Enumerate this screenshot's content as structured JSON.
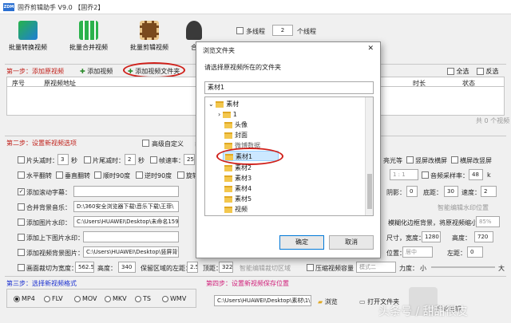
{
  "window": {
    "logo_text": "ZDM",
    "title": "固乔剪辑助手 V9.0 【固乔2】"
  },
  "toolbar": {
    "buttons": [
      {
        "label": "批量转换视频",
        "icon": "convert-icon"
      },
      {
        "label": "批量合并视频",
        "icon": "merge-icon"
      },
      {
        "label": "批量剪辑视频",
        "icon": "film-edit-icon"
      },
      {
        "label": "合",
        "icon": "users-icon"
      }
    ],
    "multithread_label": "多线程",
    "thread_count": "2",
    "thread_unit": "个线程"
  },
  "step1": {
    "title": "第一步：添加原视频",
    "add_video": "添加视频",
    "add_folder": "添加视频文件夹",
    "select_all": "全选",
    "invert": "反选",
    "columns": [
      "序号",
      "原视频地址",
      "时长",
      "状态"
    ],
    "total": "共 0 个视频"
  },
  "step2": {
    "title": "第二步：设置新视频选项",
    "advanced": "高级自定义",
    "edit": "编辑",
    "row1": {
      "cut_head": "片头减时：",
      "cut_head_val": "3",
      "sec1": "秒",
      "cut_tail": "片尾减时：",
      "cut_tail_val": "2",
      "sec2": "秒",
      "fps": "帧速率：",
      "fps_val": "25"
    },
    "row1_right": {
      "light": "亮光等",
      "vert_screen": "竖屏改横屏",
      "horiz_screen": "横屏改竖屏"
    },
    "row2": {
      "hflip": "水平翻转",
      "vflip": "垂直翻转",
      "cw90": "顺时90度",
      "ccw90": "逆时90度",
      "rotate": "旋转"
    },
    "row2_right": {
      "ratio": "1 : 1",
      "sample_rate": "音频采样率：",
      "sample_val": "48",
      "unit": "k"
    },
    "row3": {
      "subtitle": "添加滚动字幕："
    },
    "row3_right": {
      "shadow": "阴影：",
      "shadow_val": "0",
      "bottom": "底距：",
      "bottom_val": "30",
      "speed": "速度：",
      "speed_val": "2"
    },
    "row4": {
      "merge_audio": "合并背景音乐：",
      "merge_path": "D:\\360安全浏览器下载\\音乐下载\\王菲\\"
    },
    "row4_right": {
      "smart": "智能编辑水印位置"
    },
    "row5": {
      "watermark": "添加图片水印：",
      "wm_path": "C:\\Users\\HUAWEI\\Desktop\\未命名15940"
    },
    "row5_right": {
      "blur": "模糊化边框背景，将原视频缩小到：",
      "blur_val": "85%"
    },
    "row6": {
      "topbottom": "添加上下图片水印："
    },
    "row6_right": {
      "size_label": "尺寸，宽度：",
      "width_val": "1280",
      "height_label": "高度：",
      "height_val": "720"
    },
    "row7": {
      "bg_image": "添加视频背景图片：",
      "bg_path": "C:\\Users\\HUAWEI\\Desktop\\竖屏背景"
    },
    "row7_right": {
      "pos_label": "位置：",
      "pos_val": "居中",
      "left_label": "左距：",
      "left_val": "0"
    },
    "row8": {
      "crop": "画面裁切为宽度：",
      "crop_w": "562.5",
      "crop_h_label": "高度：",
      "crop_h": "340",
      "keep_left": "保留区域的左距：",
      "keep_left_val": "2.5",
      "top_label": "顶距：",
      "top_val": "322",
      "smart_crop": "智能编辑裁切区域",
      "compress": "压缩视频容量",
      "mode": "模式二",
      "strength": "力度：",
      "small": "小",
      "big": "大"
    }
  },
  "step3": {
    "title": "第三步：选择新视频格式",
    "formats": [
      "MP4",
      "FLV",
      "MOV",
      "MKV",
      "TS",
      "WMV"
    ],
    "selected": "MP4"
  },
  "step4": {
    "title": "第四步：设置新视频保存位置",
    "path": "C:\\Users\\HUAWEI\\Desktop\\素材\\1\\剪辑",
    "browse": "浏览",
    "open_folder": "打开文件夹",
    "start": "开始剪辑"
  },
  "watermark_text": "头条号 / 甜甜很皮",
  "dialog": {
    "title": "浏览文件夹",
    "close": "✕",
    "prompt": "请选择原视频所在的文件夹",
    "path_value": "素材1",
    "tree": [
      {
        "label": "素材",
        "depth": 0,
        "expanded": true
      },
      {
        "label": "1",
        "depth": 1,
        "expanded": false
      },
      {
        "label": "头像",
        "depth": 1
      },
      {
        "label": "封面",
        "depth": 1
      },
      {
        "label": "微博数据",
        "depth": 1
      },
      {
        "label": "素材1",
        "depth": 1,
        "selected": true
      },
      {
        "label": "素材2",
        "depth": 1
      },
      {
        "label": "素材3",
        "depth": 1
      },
      {
        "label": "素材4",
        "depth": 1
      },
      {
        "label": "素材5",
        "depth": 1
      },
      {
        "label": "视频",
        "depth": 1
      }
    ],
    "ok": "确定",
    "cancel": "取消"
  },
  "colors": {
    "accent_red": "#d0201a",
    "selection": "#cce8ff",
    "folder": "#f3c74e"
  }
}
